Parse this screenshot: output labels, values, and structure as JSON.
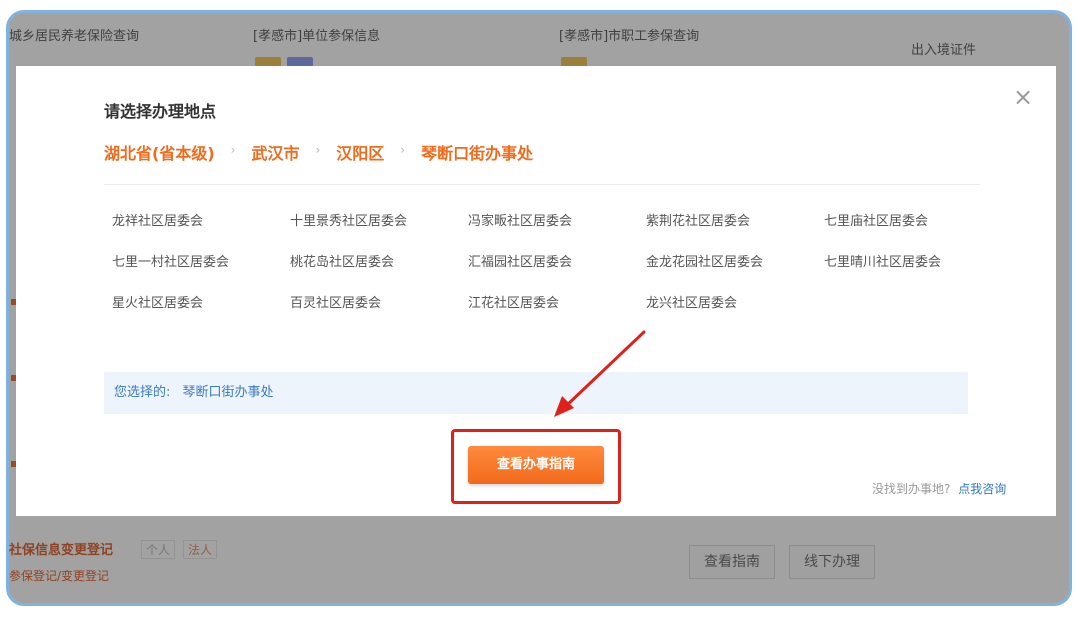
{
  "background_page": {
    "top_items": [
      "城乡居民养老保险查询",
      "[孝感市]单位参保信息",
      "[孝感市]市职工参保查询",
      "出入境证件"
    ],
    "bottom_title": "社保信息变更登记",
    "bottom_chips": [
      "个人",
      "法人"
    ],
    "bottom_subtitle": "参保登记/变更登记",
    "bottom_buttons": [
      "查看指南",
      "线下办理"
    ]
  },
  "dialog": {
    "title": "请选择办理地点",
    "breadcrumb": [
      "湖北省(省本级)",
      "武汉市",
      "汉阳区",
      "琴断口街办事处"
    ],
    "options": [
      [
        "龙祥社区居委会",
        "十里景秀社区居委会",
        "冯家畈社区居委会",
        "紫荆花社区居委会",
        "七里庙社区居委会"
      ],
      [
        "七里一村社区居委会",
        "桃花岛社区居委会",
        "汇福园社区居委会",
        "金龙花园社区居委会",
        "七里晴川社区居委会"
      ],
      [
        "星火社区居委会",
        "百灵社区居委会",
        "江花社区居委会",
        "龙兴社区居委会"
      ]
    ],
    "selected_label": "您选择的:",
    "selected_value": "琴断口街办事处",
    "primary_button": "查看办事指南",
    "footer_question": "没找到办事地?",
    "footer_link": "点我咨询",
    "close_icon": "close-icon"
  },
  "colors": {
    "accent_orange": "#f26a1b",
    "annotation_red": "#e0211a",
    "link_blue": "#2f78c4",
    "frame_blue": "#7fb2dc"
  }
}
